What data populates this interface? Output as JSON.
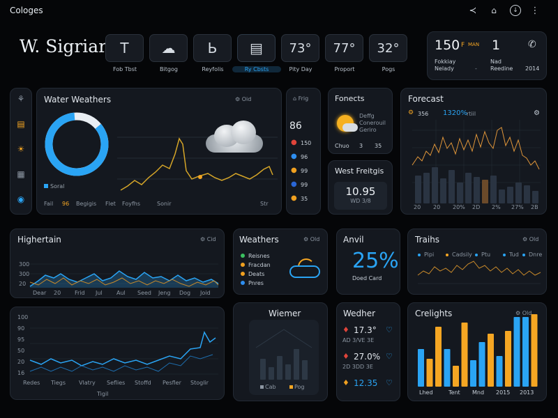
{
  "app": {
    "title": "Cologes"
  },
  "top_icons": [
    "share-icon",
    "home-icon",
    "download-icon",
    "more-vertical-icon"
  ],
  "header": {
    "brand": "W. Sigriar"
  },
  "tabs": [
    {
      "glyph": "T",
      "label": "Fob Tbst"
    },
    {
      "glyph": "☁",
      "label": "Bitgog"
    },
    {
      "glyph": "Ь",
      "label": "Reyfolis"
    },
    {
      "glyph": "▤",
      "label": "Ry Cbsts"
    },
    {
      "glyph": "73°",
      "label": "Pity Day"
    },
    {
      "glyph": "77°",
      "label": "Proport"
    },
    {
      "glyph": "32°",
      "label": "Pogs"
    }
  ],
  "info_card": {
    "temp": "150",
    "unit": "F",
    "tag": "MAN",
    "count": "1",
    "l1": "Fokkiay",
    "l2": "Nelady",
    "l3": "Nad",
    "l4": "Reedine",
    "year": "2014",
    "arrow": "-"
  },
  "sidebar": {
    "items": [
      "lungs-icon",
      "clipboard-icon",
      "sun-icon",
      "calendar-icon",
      "globe-icon"
    ]
  },
  "water_card": {
    "title": "Water Weathers",
    "tools": "⚙ Oid",
    "legend": "Soral",
    "x_labels": [
      "Fail",
      "96",
      "Begigis",
      "Flet",
      "Foyfhs",
      "Sonir"
    ],
    "right_label": "Str"
  },
  "mid_list": {
    "head": "⌂ Frig",
    "value": "86",
    "items": [
      {
        "icon": "●",
        "color": "#e0443a",
        "v": "150"
      },
      {
        "icon": "●",
        "color": "#2e8ef0",
        "v": "96"
      },
      {
        "icon": "●",
        "color": "#f0a020",
        "v": "99"
      },
      {
        "icon": "●",
        "color": "#2a66d6",
        "v": "99"
      },
      {
        "icon": "●",
        "color": "#f0a020",
        "v": "35"
      }
    ]
  },
  "fonects": {
    "title": "Fonects",
    "l1": "Deffg",
    "l2": "Conerouil",
    "l3": "Geriro",
    "a": "Chuo",
    "b": "3",
    "c": "35"
  },
  "west": {
    "title": "West Freitgis",
    "value": "10.95",
    "sub": "WD 3/8"
  },
  "forecast": {
    "title": "Forecast",
    "v1": "356",
    "v2": "1320%",
    "v2unit": "rtiil",
    "x_labels": [
      "20",
      "20",
      "20%",
      "2D",
      "2%",
      "27%",
      "2B"
    ]
  },
  "highertain": {
    "title": "Highertain",
    "tools": "⚙ Cid",
    "y_labels": [
      "300",
      "300",
      "20"
    ],
    "x_labels": [
      "Dear",
      "20",
      "Frid",
      "Jul",
      "Aul",
      "Seed",
      "Jeng",
      "Dog",
      "Joid"
    ]
  },
  "weathers": {
    "title": "Weathers",
    "tools": "⚙ Old",
    "items": [
      {
        "name": "Reisnes",
        "color": "#3ac060"
      },
      {
        "name": "Fracdan",
        "color": "#f0a020"
      },
      {
        "name": "Deats",
        "color": "#f0a020"
      },
      {
        "name": "Pnres",
        "color": "#2e8ef0"
      }
    ]
  },
  "anvil": {
    "title": "Anvil",
    "value": "25%",
    "sub": "Doed Card"
  },
  "trains": {
    "title": "Traihs",
    "tools": "⚙ Old",
    "legend": [
      "Pipi",
      "Cadsily",
      "Ptu",
      "Tud",
      "Dnre"
    ]
  },
  "bottom_left": {
    "y_labels": [
      "100",
      "90",
      "95",
      "50",
      "20",
      "16"
    ],
    "x_labels": [
      "Redes",
      "Tiegs",
      "Vlatry",
      "Seflies",
      "Stoffd",
      "Pesfler",
      "Stoglir"
    ],
    "foot": "Tigil"
  },
  "wiemer": {
    "title": "Wiemer",
    "legend_a": "Cab",
    "legend_b": "Pog"
  },
  "wedher": {
    "title": "Wedher",
    "rows": [
      {
        "v": "17.3°",
        "sub": "AD 3/VE 3E",
        "color": "#e0443a"
      },
      {
        "v": "27.0%",
        "sub": "2D 3DD 3E",
        "color": "#e0443a"
      },
      {
        "v": "12.35",
        "sub": "",
        "color": "#f0a020"
      }
    ]
  },
  "crelights": {
    "title": "Crelights",
    "tools": "⚙ Old",
    "x_labels": [
      "Lhed",
      "Tent",
      "Mnd",
      "2015",
      "2013"
    ]
  },
  "colors": {
    "accent": "#2aa4f4",
    "orange": "#f5a623",
    "bg": "#050608",
    "card": "#14181f"
  }
}
